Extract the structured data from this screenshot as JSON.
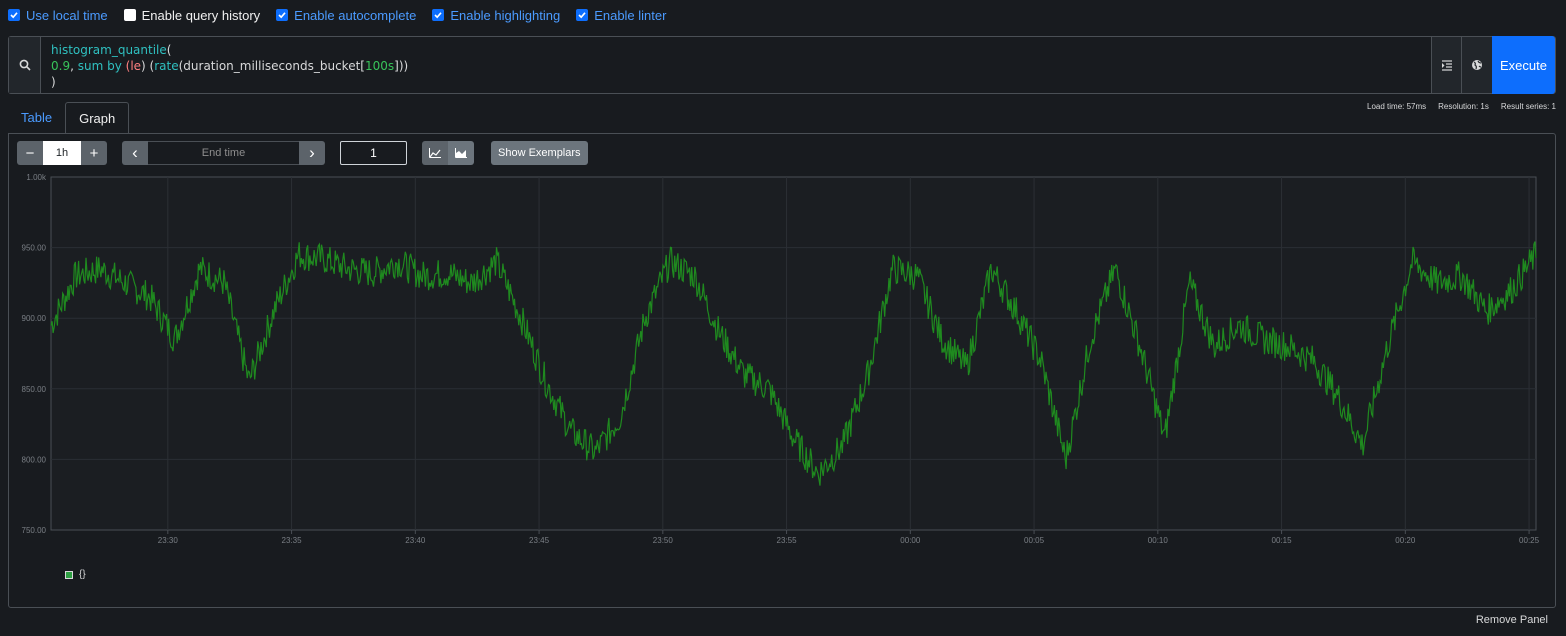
{
  "options": [
    {
      "label": "Use local time",
      "checked": true
    },
    {
      "label": "Enable query history",
      "checked": false
    },
    {
      "label": "Enable autocomplete",
      "checked": true
    },
    {
      "label": "Enable highlighting",
      "checked": true
    },
    {
      "label": "Enable linter",
      "checked": true
    }
  ],
  "query": {
    "line1_fn": "histogram_quantile",
    "line1_paren": "(",
    "line2_num": "0.9",
    "line2_comma": ", ",
    "line2_sum": "sum",
    "line2_by": " by ",
    "line2_lparen": "(",
    "line2_le": "le",
    "line2_rparen": ") (",
    "line2_rate": "rate",
    "line2_metric": "(duration_milliseconds_bucket[",
    "line2_range": "100s",
    "line2_close": "]))",
    "line3": ")"
  },
  "execute_label": "Execute",
  "tabs": {
    "table": "Table",
    "graph": "Graph"
  },
  "stats": {
    "load": "Load time: 57ms",
    "resolution": "Resolution: 1s",
    "series": "Result series: 1"
  },
  "controls": {
    "range": "1h",
    "minus": "−",
    "plus": "+",
    "end_time_placeholder": "End time",
    "prev": "‹",
    "next": "›",
    "resolution": "1",
    "exemplars": "Show Exemplars"
  },
  "legend": {
    "series_label": "{}"
  },
  "remove_panel": "Remove Panel",
  "colors": {
    "accent": "#0d6efd",
    "series": "#1f8a1f"
  },
  "chart_data": {
    "type": "line",
    "ylim": [
      750,
      1000
    ],
    "y_ticks": [
      "750.00",
      "800.00",
      "850.00",
      "900.00",
      "950.00",
      "1.00k"
    ],
    "x_ticks": [
      "23:30",
      "23:35",
      "23:40",
      "23:45",
      "23:50",
      "23:55",
      "00:00",
      "00:05",
      "00:10",
      "00:15",
      "00:20",
      "00:25"
    ],
    "x_tick_minutes": [
      4.72,
      9.72,
      14.72,
      19.72,
      24.72,
      29.72,
      34.72,
      39.72,
      44.72,
      49.72,
      54.72,
      59.72
    ],
    "x_range_minutes": [
      0,
      60
    ],
    "grid": true,
    "series": [
      {
        "name": "{}",
        "x": [
          0,
          1,
          2,
          3,
          4,
          5,
          6,
          7,
          8,
          9,
          10,
          11,
          12,
          13,
          14,
          15,
          16,
          17,
          18,
          19,
          20,
          21,
          22,
          23,
          24,
          25,
          26,
          27,
          28,
          29,
          30,
          31,
          32,
          33,
          34,
          35,
          36,
          37,
          38,
          39,
          40,
          41,
          42,
          43,
          44,
          45,
          46,
          47,
          48,
          49,
          50,
          51,
          52,
          53,
          54,
          55,
          56,
          57,
          58,
          59,
          60
        ],
        "y": [
          895,
          930,
          935,
          925,
          915,
          885,
          935,
          925,
          855,
          905,
          945,
          942,
          935,
          932,
          940,
          930,
          932,
          925,
          940,
          900,
          855,
          820,
          805,
          830,
          900,
          940,
          930,
          890,
          860,
          850,
          815,
          790,
          810,
          860,
          935,
          930,
          885,
          865,
          935,
          905,
          870,
          800,
          885,
          935,
          880,
          815,
          925,
          880,
          895,
          885,
          880,
          870,
          845,
          810,
          880,
          940,
          925,
          930,
          905,
          920,
          945
        ]
      }
    ]
  }
}
